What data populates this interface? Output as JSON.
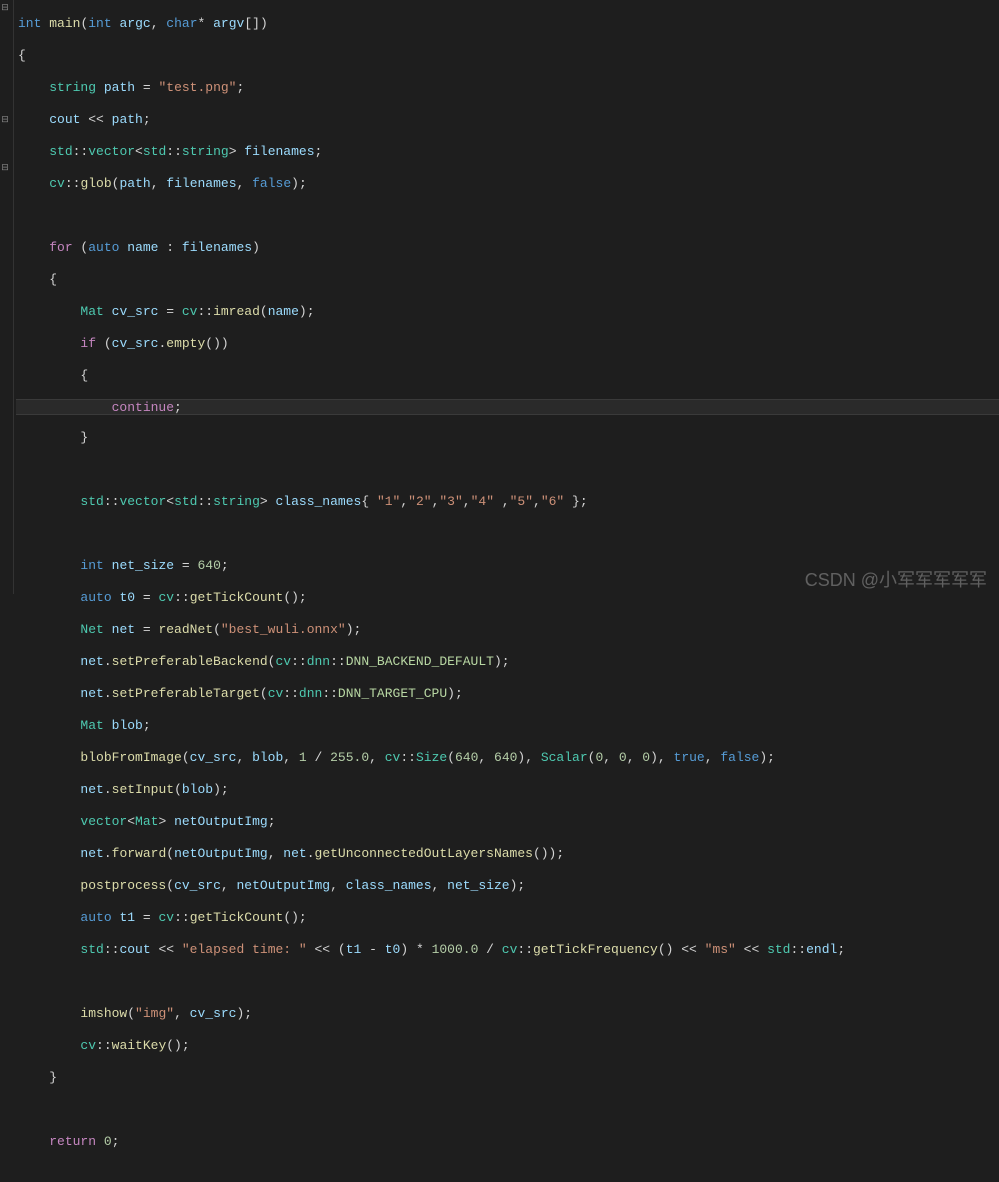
{
  "watermark": "CSDN @小军军军军军",
  "code": {
    "l1": {
      "kw1": "int",
      "fn": "main",
      "kw2": "int",
      "v1": "argc",
      "kw3": "char",
      "v2": "argv"
    },
    "l3": {
      "t": "string",
      "v": "path",
      "s": "\"test.png\""
    },
    "l4": {
      "v1": "cout",
      "v2": "path"
    },
    "l5": {
      "ns1": "std",
      "t1": "vector",
      "ns2": "std",
      "t2": "string",
      "v": "filenames"
    },
    "l6": {
      "ns": "cv",
      "fn": "glob",
      "v1": "path",
      "v2": "filenames",
      "kw": "false"
    },
    "l8": {
      "kw1": "for",
      "kw2": "auto",
      "v1": "name",
      "v2": "filenames"
    },
    "l10": {
      "t": "Mat",
      "v1": "cv_src",
      "ns": "cv",
      "fn": "imread",
      "v2": "name"
    },
    "l11": {
      "kw": "if",
      "v": "cv_src",
      "fn": "empty"
    },
    "l13": {
      "kw": "continue"
    },
    "l16": {
      "ns1": "std",
      "t1": "vector",
      "ns2": "std",
      "t2": "string",
      "v": "class_names",
      "s1": "\"1\"",
      "s2": "\"2\"",
      "s3": "\"3\"",
      "s4": "\"4\"",
      "s5": "\"5\"",
      "s6": "\"6\""
    },
    "l18": {
      "kw": "int",
      "v": "net_size",
      "n": "640"
    },
    "l19": {
      "kw": "auto",
      "v": "t0",
      "ns": "cv",
      "fn": "getTickCount"
    },
    "l20": {
      "t": "Net",
      "v": "net",
      "fn": "readNet",
      "s": "\"best_wuli.onnx\""
    },
    "l21": {
      "v": "net",
      "fn": "setPreferableBackend",
      "ns1": "cv",
      "ns2": "dnn",
      "e": "DNN_BACKEND_DEFAULT"
    },
    "l22": {
      "v": "net",
      "fn": "setPreferableTarget",
      "ns1": "cv",
      "ns2": "dnn",
      "e": "DNN_TARGET_CPU"
    },
    "l23": {
      "t": "Mat",
      "v": "blob"
    },
    "l24": {
      "fn": "blobFromImage",
      "v1": "cv_src",
      "v2": "blob",
      "n1": "1",
      "n2": "255.0",
      "ns": "cv",
      "t": "Size",
      "n3": "640",
      "n4": "640",
      "t2": "Scalar",
      "n5": "0",
      "n6": "0",
      "n7": "0",
      "kw1": "true",
      "kw2": "false"
    },
    "l25": {
      "v": "net",
      "fn": "setInput",
      "v2": "blob"
    },
    "l26": {
      "t1": "vector",
      "t2": "Mat",
      "v": "netOutputImg"
    },
    "l27": {
      "v1": "net",
      "fn1": "forward",
      "v2": "netOutputImg",
      "v3": "net",
      "fn2": "getUnconnectedOutLayersNames"
    },
    "l28": {
      "fn": "postprocess",
      "v1": "cv_src",
      "v2": "netOutputImg",
      "v3": "class_names",
      "v4": "net_size"
    },
    "l29": {
      "kw": "auto",
      "v": "t1",
      "ns": "cv",
      "fn": "getTickCount"
    },
    "l30": {
      "ns1": "std",
      "v1": "cout",
      "s1": "\"elapsed time: \"",
      "v2": "t1",
      "v3": "t0",
      "n": "1000.0",
      "ns2": "cv",
      "fn": "getTickFrequency",
      "s2": "\"ms\"",
      "ns3": "std",
      "v4": "endl"
    },
    "l32": {
      "fn": "imshow",
      "s": "\"img\"",
      "v": "cv_src"
    },
    "l33": {
      "ns": "cv",
      "fn": "waitKey"
    },
    "l36": {
      "kw": "return",
      "n": "0"
    }
  }
}
